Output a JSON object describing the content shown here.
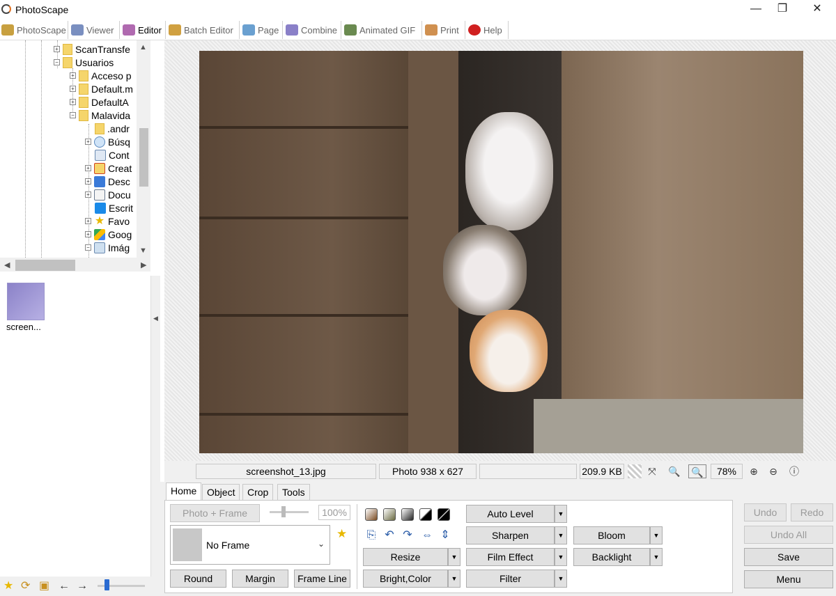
{
  "window": {
    "title": "PhotoScape",
    "minimize": "—",
    "maximize": "❐",
    "close": "✕"
  },
  "tabs": [
    {
      "label": "PhotoScape",
      "color": "#c8a040"
    },
    {
      "label": "Viewer",
      "color": "#7a8fc0"
    },
    {
      "label": "Editor",
      "color": "#b06ab0"
    },
    {
      "label": "Batch Editor",
      "color": "#d0a040"
    },
    {
      "label": "Page",
      "color": "#6aa0d0"
    },
    {
      "label": "Combine",
      "color": "#8a80c8"
    },
    {
      "label": "Animated GIF",
      "color": "#6a8a50"
    },
    {
      "label": "Print",
      "color": "#d09050"
    },
    {
      "label": "Help",
      "color": "#d02020"
    }
  ],
  "tree": {
    "items": [
      {
        "label": "ScanTransfe"
      },
      {
        "label": "Usuarios"
      },
      {
        "label": "Acceso p"
      },
      {
        "label": "Default.m"
      },
      {
        "label": "DefaultA"
      },
      {
        "label": "Malavida"
      },
      {
        "label": ".andr"
      },
      {
        "label": "Búsq"
      },
      {
        "label": "Cont"
      },
      {
        "label": "Creat"
      },
      {
        "label": "Desc"
      },
      {
        "label": "Docu"
      },
      {
        "label": "Escrit"
      },
      {
        "label": "Favo"
      },
      {
        "label": "Goog"
      },
      {
        "label": "Imág"
      }
    ]
  },
  "files": {
    "items": [
      {
        "name": "screen..."
      }
    ]
  },
  "status": {
    "filename": "screenshot_13.jpg",
    "dimensions": "Photo 938 x 627",
    "filesize": "209.9 KB",
    "zoom": "78%"
  },
  "panel": {
    "tabs": [
      "Home",
      "Object",
      "Crop",
      "Tools"
    ],
    "photo_frame": "Photo + Frame",
    "percent": "100%",
    "frame": "No Frame",
    "round": "Round",
    "margin": "Margin",
    "frame_line": "Frame Line",
    "resize": "Resize",
    "bright_color": "Bright,Color",
    "auto_level": "Auto Level",
    "sharpen": "Sharpen",
    "film_effect": "Film Effect",
    "filter": "Filter",
    "bloom": "Bloom",
    "backlight": "Backlight",
    "undo": "Undo",
    "redo": "Redo",
    "undo_all": "Undo All",
    "save": "Save",
    "menu": "Menu"
  }
}
